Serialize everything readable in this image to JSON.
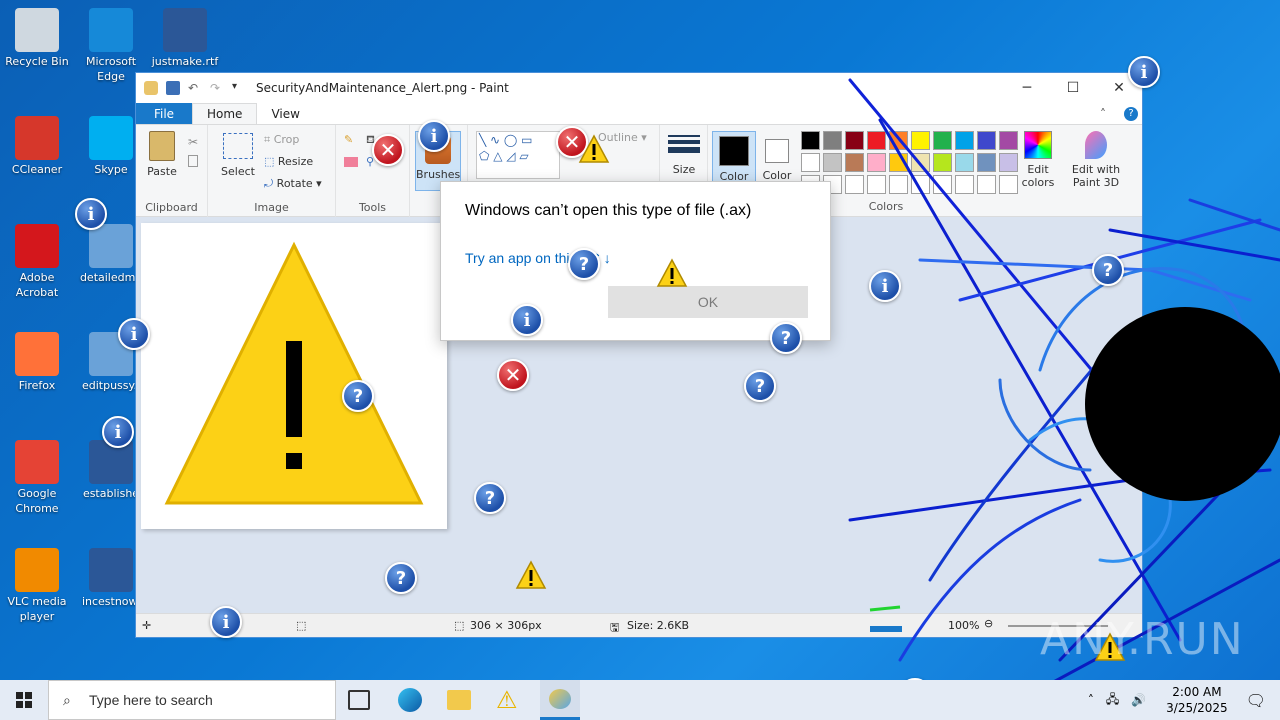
{
  "desktop": {
    "icons": [
      {
        "label": "Recycle Bin",
        "glyph": "recycle-bin-icon",
        "color": "#cfd8e0"
      },
      {
        "label": "Microsoft Edge",
        "glyph": "edge-icon",
        "color": "#1689d8"
      },
      {
        "label": "justmake.rtf",
        "glyph": "word-icon",
        "color": "#2b5797"
      },
      {
        "label": "CCleaner",
        "glyph": "ccleaner-icon",
        "color": "#d6372b"
      },
      {
        "label": "Skype",
        "glyph": "skype-icon",
        "color": "#00aff0"
      },
      {
        "label": "Adobe Acrobat",
        "glyph": "acrobat-icon",
        "color": "#d4171c"
      },
      {
        "label": "detailedma",
        "glyph": "image-file-icon",
        "color": "#6aa2d8"
      },
      {
        "label": "Firefox",
        "glyph": "firefox-icon",
        "color": "#ff7139"
      },
      {
        "label": "editpussy.j",
        "glyph": "image-file-icon",
        "color": "#6aa2d8"
      },
      {
        "label": "Google Chrome",
        "glyph": "chrome-icon",
        "color": "#e54335"
      },
      {
        "label": "establishe",
        "glyph": "word-icon",
        "color": "#2b5797"
      },
      {
        "label": "VLC media player",
        "glyph": "vlc-icon",
        "color": "#f18a00"
      },
      {
        "label": "incestnow.",
        "glyph": "word-icon",
        "color": "#2b5797"
      }
    ]
  },
  "paint": {
    "title": "SecurityAndMaintenance_Alert.png - Paint",
    "tabs": {
      "file": "File",
      "home": "Home",
      "view": "View"
    },
    "clipboard": {
      "paste": "Paste",
      "label": "Clipboard"
    },
    "image": {
      "select": "Select",
      "crop": "Crop",
      "resize": "Resize",
      "rotate": "Rotate",
      "label": "Image"
    },
    "tools": {
      "label": "Tools"
    },
    "brushes": {
      "label": "Brushes"
    },
    "shapes": {
      "outline": "Outline"
    },
    "size": {
      "label": "Size"
    },
    "color1": {
      "label": "Color"
    },
    "color2": {
      "label": "Color"
    },
    "colors": {
      "label": "Colors",
      "edit": "Edit colors"
    },
    "paint3d": {
      "label": "Edit with Paint 3D"
    },
    "palette": [
      "#000000",
      "#7f7f7f",
      "#880015",
      "#ed1c24",
      "#ff7f27",
      "#fff200",
      "#22b14c",
      "#00a2e8",
      "#3f48cc",
      "#a349a4",
      "#ffffff",
      "#c3c3c3",
      "#b97a57",
      "#ffaec9",
      "#ffc90e",
      "#efe4b0",
      "#b5e61d",
      "#99d9ea",
      "#7092be",
      "#c8bfe7"
    ],
    "status": {
      "dimensions": "306 × 306px",
      "size": "Size: 2.6KB",
      "zoom": "100%"
    }
  },
  "dialog": {
    "title": "Windows can’t open this type of file (.ax)",
    "link": "Try an app on this PC ↓",
    "ok": "OK"
  },
  "taskbar": {
    "search_placeholder": "Type here to search",
    "time": "2:00 AM",
    "date": "3/25/2025"
  },
  "watermark": "ANY.RUN"
}
